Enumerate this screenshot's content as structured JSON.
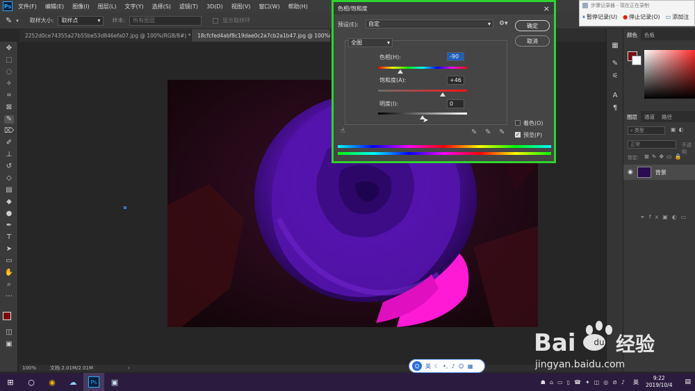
{
  "app": {
    "logo": "Ps",
    "menu": [
      "文件(F)",
      "编辑(E)",
      "图像(I)",
      "图层(L)",
      "文字(Y)",
      "选择(S)",
      "滤镜(T)",
      "3D(D)",
      "视图(V)",
      "窗口(W)",
      "帮助(H)"
    ]
  },
  "options_bar": {
    "tool_icon": "eyedropper-icon",
    "sample_size_label": "取样大小:",
    "sample_size_value": "取样点",
    "sample_label": "样本:",
    "sample_value": "所有图层",
    "show_ring_label": "显示取样环"
  },
  "tabs": [
    {
      "label": "2252d0ce74355a27b55be53d846efa07.jpg @ 100%(RGB/8#) *",
      "close": "×"
    },
    {
      "label": "18cfcfed4abf8c19dae0c2a7cb2a1b47.jpg @ 100%(RGB/8)",
      "close": ""
    }
  ],
  "status": {
    "zoom": "100%",
    "doc": "文档:2.01M/2.01M",
    "arrow": "›"
  },
  "dialog": {
    "title": "色相/饱和度",
    "close": "×",
    "preset_label": "预设(E):",
    "preset_value": "自定",
    "ok": "确定",
    "cancel": "取消",
    "channel": "全图",
    "hue_label": "色相(H):",
    "hue_value": "-90",
    "hue_level": -90,
    "saturation_label": "饱和度(A):",
    "saturation_value": "+46",
    "saturation_level": 46,
    "lightness_label": "明度(I):",
    "lightness_value": "0",
    "lightness_level": 0,
    "colorize_label": "着色(O)",
    "colorize_checked": false,
    "preview_label": "预览(P)",
    "preview_checked": true
  },
  "recorder": {
    "title": "步骤记录器 - 现在正在录制",
    "pause": "暂停记录(U)",
    "stop": "停止记录(O)",
    "add": "添加注"
  },
  "panels": {
    "color_tabs": [
      "颜色",
      "色板"
    ],
    "layer_tabs": [
      "图层",
      "通道",
      "路径"
    ],
    "kind_label": "类型",
    "blend_mode": "正常",
    "opacity_label": "不透明",
    "lock_label": "锁定:",
    "layer_name": "背景"
  },
  "ime": {
    "mode": "英"
  },
  "taskbar": {
    "time": "9:22",
    "date": "2019/10/4",
    "lang": "英"
  },
  "watermark": {
    "brand": "Bai",
    "brand2": "经验",
    "url": "jingyan.baidu.com"
  },
  "colors": {
    "dialog_highlight": "#2fd32f",
    "foreground": "#7a0a12",
    "rose": "#5a12b0",
    "petal_pink": "#ff1ad6"
  }
}
